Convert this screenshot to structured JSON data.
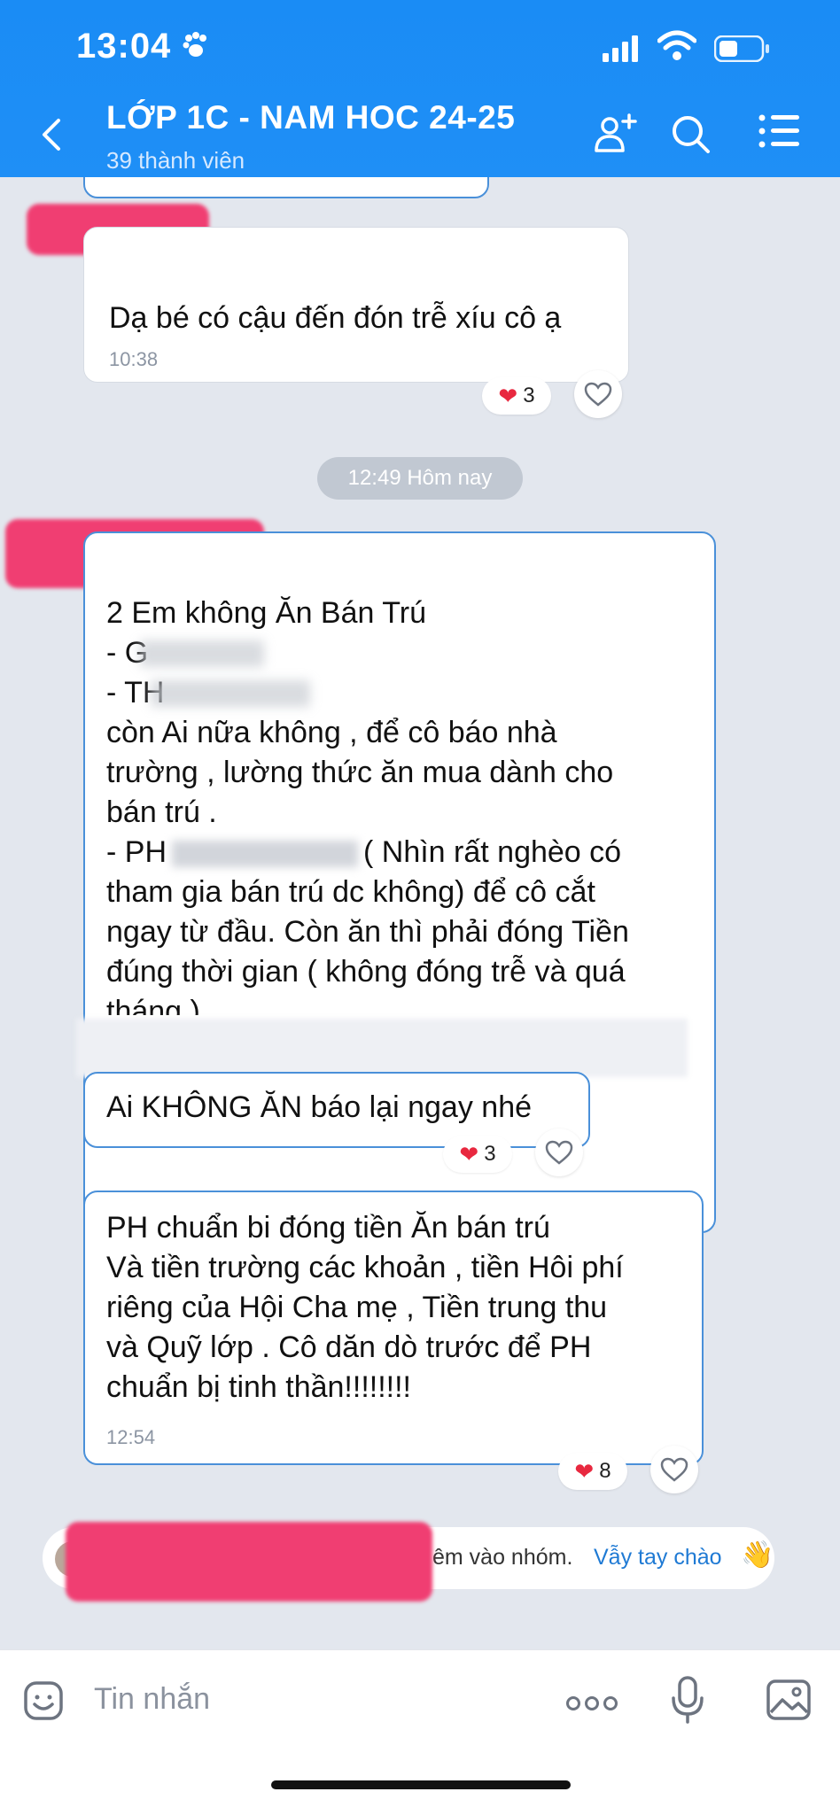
{
  "status_bar": {
    "time": "13:04"
  },
  "header": {
    "title": "LỚP 1C - NAM HOC 24-25",
    "members": "39 thành viên",
    "icons": [
      "back-icon",
      "add-member-icon",
      "search-icon",
      "menu-icon"
    ]
  },
  "messages": [
    {
      "text": "Dạ bé có cậu đến đón trễ xíu cô ạ",
      "time": "10:38",
      "reactions": "3"
    },
    {
      "separator": "12:49 Hôm nay"
    },
    {
      "lines": [
        "2 Em không Ăn Bán Trú",
        "- G",
        "- TH",
        "còn Ai nữa không , để cô báo nhà",
        "trường , lường thức ăn mua dành cho",
        "bán trú .",
        "- PH",
        "( Nhìn rất nghèo có",
        "tham gia bán trú dc không) để cô cắt",
        "ngay từ đầu. Còn ăn thì phải đóng Tiền",
        "đúng thời gian ( không đóng trễ và quá",
        "tháng )"
      ]
    },
    {
      "text": "Ai KHÔNG ĂN báo lại ngay nhé",
      "reactions": "3"
    },
    {
      "lines": [
        "PH chuẩn bi đóng tiền Ăn bán trú",
        "Và tiền trường các khoản , tiền Hôi phí",
        "riêng của Hội Cha mẹ , Tiền trung thu",
        "và Quỹ lớp . Cô dăn dò trước để PH",
        "chuẩn bị tinh thần!!!!!!!!"
      ],
      "time": "12:54",
      "reactions": "8"
    }
  ],
  "system_notice": {
    "text": "êm vào nhóm.",
    "action": "Vẫy tay chào"
  },
  "input": {
    "placeholder": "Tin nhắn"
  },
  "colors": {
    "header": "#1f8ff6",
    "accent_border": "#4a90d9",
    "redaction": "#f03e72",
    "link": "#1f7ad4"
  }
}
